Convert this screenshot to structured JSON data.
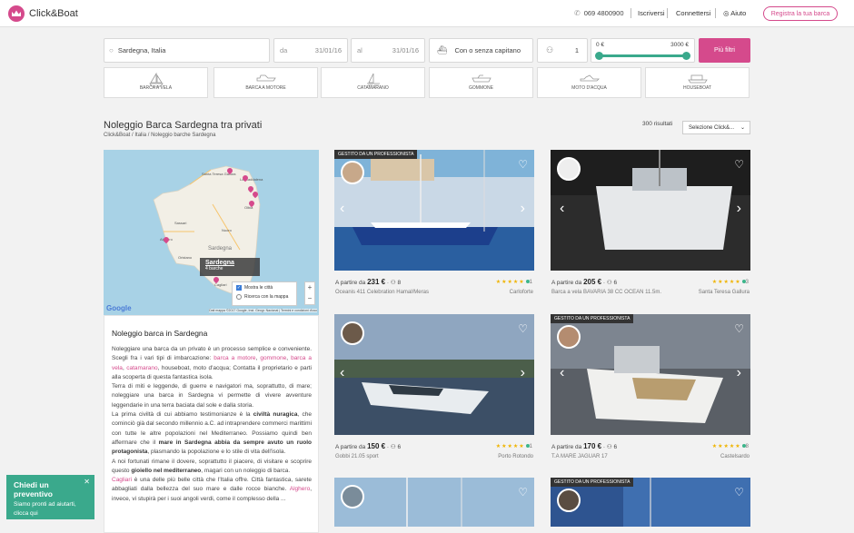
{
  "header": {
    "brand": "Click&Boat",
    "phone": "069 4800900",
    "signup": "Iscriversi",
    "login": "Connettersi",
    "help": "Aiuto",
    "register": "Registra la tua barca"
  },
  "search": {
    "location": "Sardegna, Italia",
    "from_label": "da",
    "from_date": "31/01/16",
    "to_label": "al",
    "to_date": "31/01/16",
    "captain": "Con o senza capitano",
    "guests": "1",
    "price_min": "0 €",
    "price_max": "3000 €",
    "more_filters": "Più filtri"
  },
  "categories": [
    "BARCA A VELA",
    "BARCA A MOTORE",
    "CATAMARANO",
    "GOMMONE",
    "MOTO D'ACQUA",
    "HOUSEBOAT"
  ],
  "page": {
    "title": "Noleggio Barca Sardegna tra privati",
    "crumb1": "Click&Boat",
    "crumb2": "Italia",
    "crumb3": "Noleggio barche Sardegna",
    "results": "300 risultati",
    "sort": "Selezione Click&..."
  },
  "map": {
    "label": "Sardegna",
    "count": "4 barche",
    "opt1": "Mostra le città",
    "opt2": "Ricerca con la mappa",
    "attribution": "Dati mappa ©2017 Google, Inst. Geogr. Nacional | Termini e condizioni d'uso",
    "google": "Google",
    "places": [
      "Santa Teresa Gallura",
      "La Maddalena",
      "Sassari",
      "Olbia",
      "Alghero",
      "Nuoro",
      "Oristano",
      "Cagliari",
      "Sardegna"
    ]
  },
  "info": {
    "title": "Noleggio barca in Sardegna",
    "p1a": "Noleggiare una barca da un privato è un processo semplice e conveniente. Scegli fra i vari tipi di imbarcazione: ",
    "l1": "barca a motore",
    "p1b": ", ",
    "l2": "gommone",
    "p1c": ", ",
    "l3": "barca a vela",
    "p1d": ", ",
    "l4": "catamarano",
    "p1e": ", houseboat, moto d'acqua; Contatta il proprietario e parti alla scoperta di questa fantastica isola.",
    "p2": "Terra di miti e leggende, di guerre e navigatori ma, soprattutto, di mare; noleggiare una barca in Sardegna vi permette di vivere avventure leggendarie in una terra baciata dal sole e dalla storia.",
    "p3a": "La prima civiltà di cui abbiamo testimonianze è la ",
    "b1": "civiltà nuragica",
    "p3b": ", che cominciò già dal secondo millennio a.C. ad intraprendere commerci marittimi con tutte le altre popolazioni nel Mediterraneo. Possiamo quindi ben affermare che il ",
    "b2": "mare in Sardegna abbia da sempre avuto un ruolo protagonista",
    "p3c": ", plasmando la popolazione e lo stile di vita dell'isola.",
    "p4a": "A noi fortunati rimane il dovere, soprattutto il piacere, di visitare e scoprire questo ",
    "b3": "gioiello nel mediterraneo",
    "p4b": ", magari con un noleggio di barca.",
    "l5": "Cagliari",
    "p5a": " è una delle più belle città che l'Italia offre. Città fantastica, sarete abbagliati dalla bellezza del suo mare e dalle rocce bianche. ",
    "l6": "Alghero",
    "p5b": ", invece, vi stupirà per i suoi angoli verdi, come il complesso della ..."
  },
  "listings": [
    {
      "badge": "GESTITO DA UN PROFESSIONISTA",
      "prefix": "A partire da",
      "price": "231 €",
      "guests": "8",
      "name": "Oceanis 411 Celebration Hamal/Meras",
      "location": "Carloforte",
      "rating": "1"
    },
    {
      "badge": "",
      "prefix": "A partire da",
      "price": "205 €",
      "guests": "6",
      "name": "Barca a vela BAVARIA 38 CC OCEAN 11.5m.",
      "location": "Santa Teresa Gallura",
      "rating": "3"
    },
    {
      "badge": "",
      "prefix": "A partire da",
      "price": "150 €",
      "guests": "6",
      "name": "Gobbi 21.05 sport",
      "location": "Porto Rotondo",
      "rating": "1"
    },
    {
      "badge": "GESTITO DA UN PROFESSIONISTA",
      "prefix": "A partire da",
      "price": "170 €",
      "guests": "6",
      "name": "T.A MARE JAGUAR 17",
      "location": "Castelsardo",
      "rating": "8"
    },
    {
      "badge": ""
    },
    {
      "badge": "GESTITO DA UN PROFESSIONISTA"
    }
  ],
  "chat": {
    "title": "Chiedi un preventivo",
    "line1": "Siamo pronti ad aiutarti,",
    "line2": "clicca qui"
  }
}
